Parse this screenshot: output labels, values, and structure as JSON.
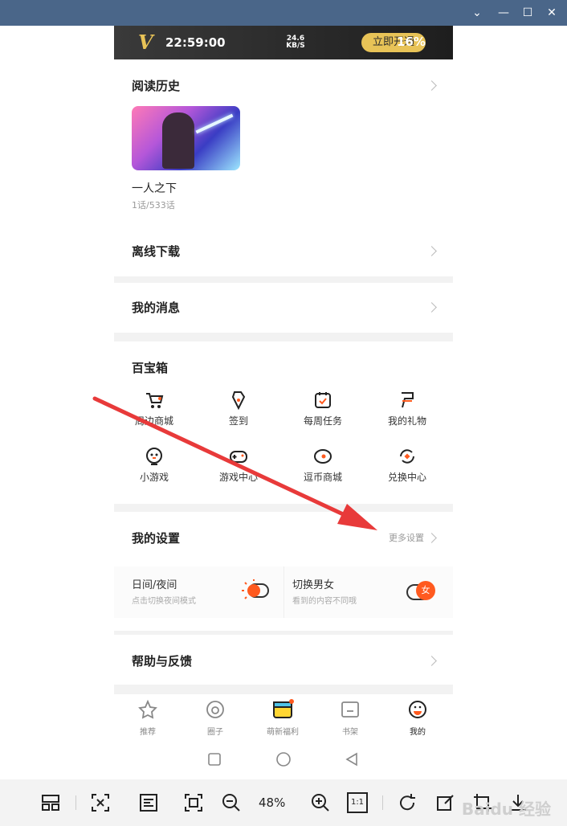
{
  "window": {
    "controls": [
      "chevron-down",
      "minimize",
      "maximize",
      "close"
    ]
  },
  "status_bar": {
    "time": "22:59:00",
    "speed": "24.6 KB/S",
    "battery": "16%",
    "vip_promo_button": "立即开通"
  },
  "reading_history": {
    "title": "阅读历史",
    "book_title": "一人之下",
    "progress": "1话/533话"
  },
  "offline_download": {
    "title": "离线下载"
  },
  "my_messages": {
    "title": "我的消息"
  },
  "toolbox": {
    "title": "百宝箱",
    "items": [
      {
        "label": "周边商城",
        "icon": "cart-icon"
      },
      {
        "label": "签到",
        "icon": "checkin-icon"
      },
      {
        "label": "每周任务",
        "icon": "calendar-icon"
      },
      {
        "label": "我的礼物",
        "icon": "gift-icon"
      },
      {
        "label": "小游戏",
        "icon": "mini-game-icon"
      },
      {
        "label": "游戏中心",
        "icon": "gamepad-icon"
      },
      {
        "label": "逗币商城",
        "icon": "coin-store-icon"
      },
      {
        "label": "兑换中心",
        "icon": "exchange-icon"
      }
    ]
  },
  "my_settings": {
    "title": "我的设置",
    "more_link": "更多设置",
    "day_night": {
      "title": "日间/夜间",
      "desc": "点击切换夜间模式"
    },
    "gender_switch": {
      "title": "切换男女",
      "desc": "看到的内容不同哦",
      "badge": "女"
    }
  },
  "help_feedback": {
    "title": "帮助与反馈"
  },
  "tab_bar": {
    "tabs": [
      {
        "label": "推荐",
        "icon": "star-icon"
      },
      {
        "label": "圈子",
        "icon": "circle-icon"
      },
      {
        "label": "萌新福利",
        "icon": "gift-box-icon"
      },
      {
        "label": "书架",
        "icon": "bookshelf-icon"
      },
      {
        "label": "我的",
        "icon": "profile-icon"
      }
    ]
  },
  "viewer_toolbar": {
    "zoom": "48%",
    "actual_size_label": "1:1"
  },
  "watermark": "Baidu 经验",
  "colors": {
    "accent": "#ff5a1f",
    "arrow": "#e83a3a",
    "titlebar": "#4a6689",
    "vip_gold": "#e8c357"
  }
}
